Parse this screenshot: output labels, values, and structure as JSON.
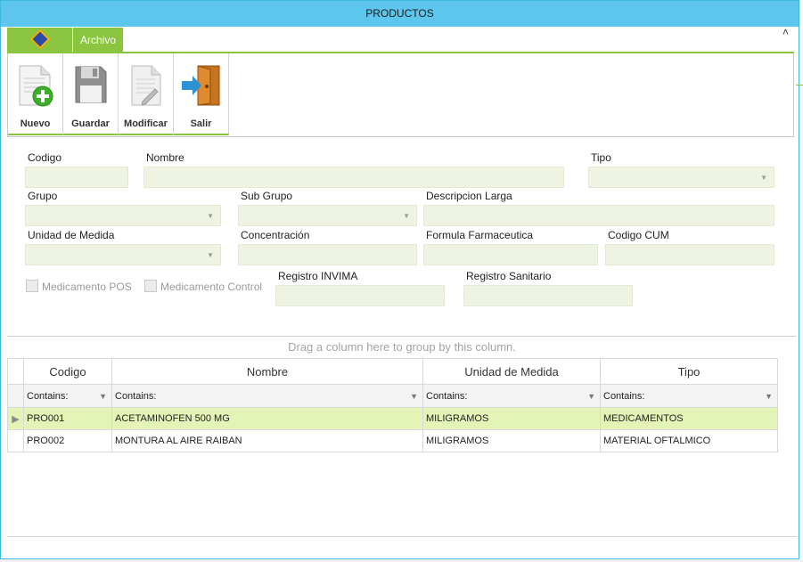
{
  "window": {
    "title": "PRODUCTOS"
  },
  "ribbon": {
    "app_button_icon": "app-diamond-icon",
    "tab_label": "Archivo",
    "collapse_glyph": "˄",
    "buttons": [
      {
        "label": "Nuevo",
        "icon": "new-document-icon"
      },
      {
        "label": "Guardar",
        "icon": "save-floppy-icon"
      },
      {
        "label": "Modificar",
        "icon": "edit-document-icon"
      },
      {
        "label": "Salir",
        "icon": "exit-door-icon"
      }
    ]
  },
  "form": {
    "codigo": {
      "label": "Codigo",
      "value": ""
    },
    "nombre": {
      "label": "Nombre",
      "value": ""
    },
    "tipo": {
      "label": "Tipo",
      "value": ""
    },
    "grupo": {
      "label": "Grupo",
      "value": ""
    },
    "sub_grupo": {
      "label": "Sub Grupo",
      "value": ""
    },
    "descripcion_larga": {
      "label": "Descripcion Larga",
      "value": ""
    },
    "unidad_medida": {
      "label": "Unidad de Medida",
      "value": ""
    },
    "concentracion": {
      "label": "Concentración",
      "value": ""
    },
    "formula_farmaceutica": {
      "label": "Formula Farmaceutica",
      "value": ""
    },
    "codigo_cum": {
      "label": "Codigo CUM",
      "value": ""
    },
    "medicamento_pos": {
      "label": "Medicamento POS",
      "checked": false
    },
    "medicamento_control": {
      "label": "Medicamento Control",
      "checked": false
    },
    "registro_invima": {
      "label": "Registro INVIMA",
      "value": ""
    },
    "registro_sanitario": {
      "label": "Registro Sanitario",
      "value": ""
    }
  },
  "grid": {
    "group_panel_text": "Drag a column here to group by this column.",
    "columns": [
      "Codigo",
      "Nombre",
      "Unidad de Medida",
      "Tipo"
    ],
    "filter_text": "Contains:",
    "rows": [
      {
        "codigo": "PRO001",
        "nombre": "ACETAMINOFEN 500 MG",
        "unidad": "MILIGRAMOS",
        "tipo": "MEDICAMENTOS",
        "selected": true
      },
      {
        "codigo": "PRO002",
        "nombre": "MONTURA AL AIRE RAIBAN",
        "unidad": "MILIGRAMOS",
        "tipo": "MATERIAL OFTALMICO",
        "selected": false
      }
    ]
  },
  "colors": {
    "accent_green": "#8bc53f",
    "title_blue": "#5cc6ec",
    "field_bg": "#eef3e2",
    "selected_row": "#e4f3b6"
  }
}
